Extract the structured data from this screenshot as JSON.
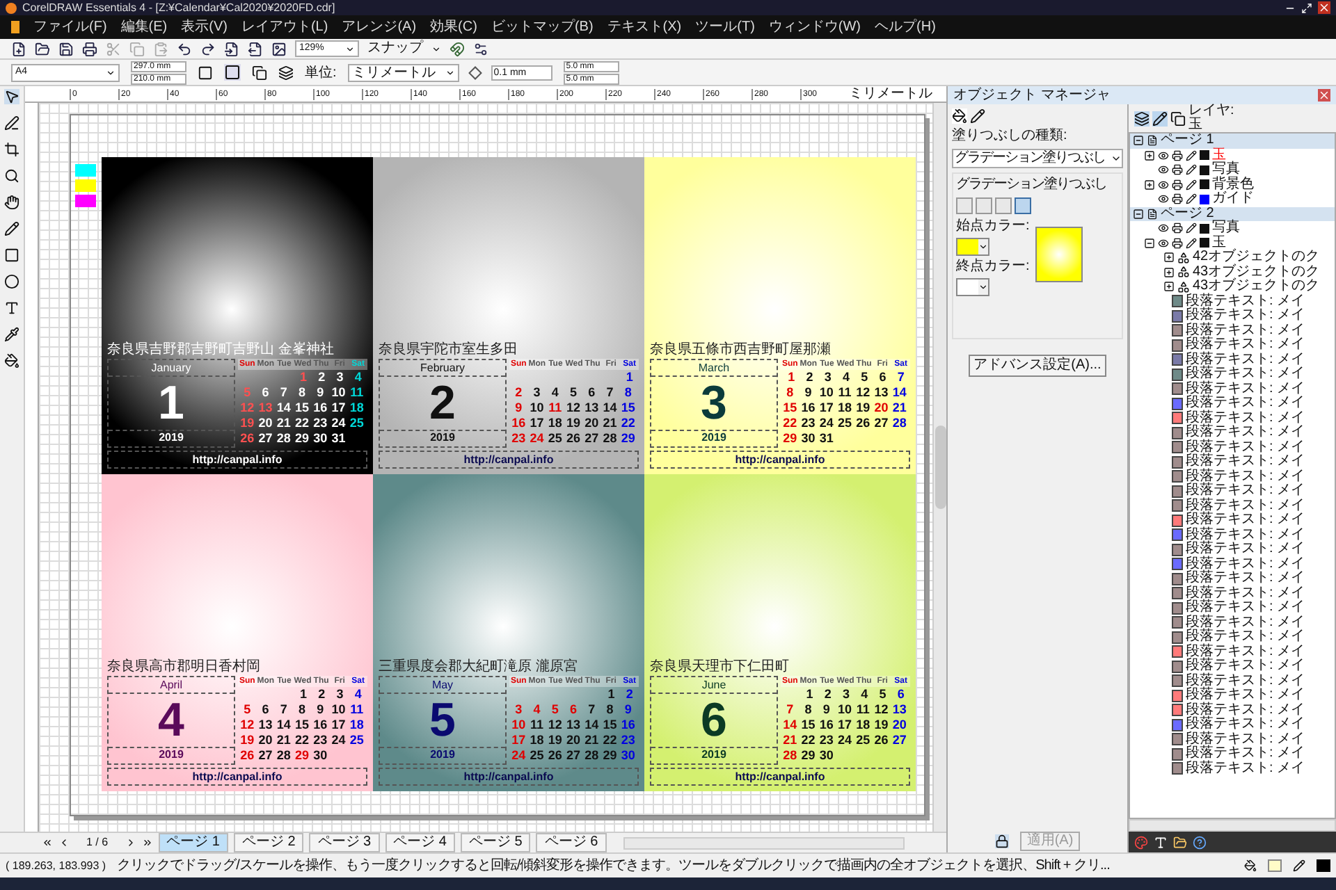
{
  "window": {
    "title": "CorelDRAW Essentials 4 - [Z:¥Calendar¥Cal2020¥2020FD.cdr]"
  },
  "menu": [
    "ファイル(F)",
    "編集(E)",
    "表示(V)",
    "レイアウト(L)",
    "アレンジ(A)",
    "効果(C)",
    "ビットマップ(B)",
    "テキスト(X)",
    "ツール(T)",
    "ウィンドウ(W)",
    "ヘルプ(H)"
  ],
  "toolbar": {
    "zoom": "129%",
    "snap": "スナップ"
  },
  "property_bar": {
    "page_size": "A4",
    "width": "297.0 mm",
    "height": "210.0 mm",
    "units_label": "単位:",
    "units": "ミリメートル",
    "nudge": "0.1 mm",
    "dup_x": "5.0 mm",
    "dup_y": "5.0 mm"
  },
  "ruler": {
    "ticks": [
      "0",
      "20",
      "40",
      "60",
      "80",
      "100",
      "120",
      "140",
      "160",
      "180",
      "200",
      "220",
      "240",
      "260",
      "280",
      "300"
    ],
    "unit": "ミリメートル"
  },
  "swatches": [
    {
      "color": "#00ffff"
    },
    {
      "color": "#ffff00"
    },
    {
      "color": "#ff00ff"
    }
  ],
  "months": [
    {
      "address": "奈良県吉野郡吉野町吉野山 金峯神社",
      "name": "January",
      "number": "1",
      "year": "2019",
      "url": "http://canpal.info",
      "color": "#000000",
      "kind": "dark",
      "weekdays": [
        "Sun",
        "Mon",
        "Tue",
        "Wed",
        "Thu",
        "Fri",
        "Sat"
      ],
      "weeks": [
        [
          {
            "text": "1",
            "kind": "holiday"
          },
          {
            "text": "2",
            "kind": "day"
          },
          {
            "text": "3",
            "kind": "day"
          },
          {
            "text": "4",
            "kind": "sat"
          }
        ],
        [
          {
            "text": "5",
            "kind": "sun"
          },
          {
            "text": "6",
            "kind": "day"
          },
          {
            "text": "7",
            "kind": "day"
          },
          {
            "text": "8",
            "kind": "day"
          },
          {
            "text": "9",
            "kind": "day"
          },
          {
            "text": "10",
            "kind": "day"
          },
          {
            "text": "11",
            "kind": "sat"
          }
        ],
        [
          {
            "text": "12",
            "kind": "sun"
          },
          {
            "text": "13",
            "kind": "holiday"
          },
          {
            "text": "14",
            "kind": "day"
          },
          {
            "text": "15",
            "kind": "day"
          },
          {
            "text": "16",
            "kind": "day"
          },
          {
            "text": "17",
            "kind": "day"
          },
          {
            "text": "18",
            "kind": "sat"
          }
        ],
        [
          {
            "text": "19",
            "kind": "sun"
          },
          {
            "text": "20",
            "kind": "day"
          },
          {
            "text": "21",
            "kind": "day"
          },
          {
            "text": "22",
            "kind": "day"
          },
          {
            "text": "23",
            "kind": "day"
          },
          {
            "text": "24",
            "kind": "day"
          },
          {
            "text": "25",
            "kind": "sat"
          }
        ],
        [
          {
            "text": "26",
            "kind": "sun"
          },
          {
            "text": "27",
            "kind": "day"
          },
          {
            "text": "28",
            "kind": "day"
          },
          {
            "text": "29",
            "kind": "day"
          },
          {
            "text": "30",
            "kind": "day"
          },
          {
            "text": "31",
            "kind": "day"
          }
        ]
      ]
    },
    {
      "address": "奈良県宇陀市室生多田",
      "name": "February",
      "number": "2",
      "year": "2019",
      "url": "http://canpal.info",
      "color": "#b4b4b4",
      "kind": "light",
      "weekdays": [
        "Sun",
        "Mon",
        "Tue",
        "Wed",
        "Thu",
        "Fri",
        "Sat"
      ],
      "weeks": [
        [
          {
            "text": "1",
            "kind": "sat"
          }
        ],
        [
          {
            "text": "2",
            "kind": "sun"
          },
          {
            "text": "3",
            "kind": "day"
          },
          {
            "text": "4",
            "kind": "day"
          },
          {
            "text": "5",
            "kind": "day"
          },
          {
            "text": "6",
            "kind": "day"
          },
          {
            "text": "7",
            "kind": "day"
          },
          {
            "text": "8",
            "kind": "sat"
          }
        ],
        [
          {
            "text": "9",
            "kind": "sun"
          },
          {
            "text": "10",
            "kind": "day"
          },
          {
            "text": "11",
            "kind": "holiday"
          },
          {
            "text": "12",
            "kind": "day"
          },
          {
            "text": "13",
            "kind": "day"
          },
          {
            "text": "14",
            "kind": "day"
          },
          {
            "text": "15",
            "kind": "sat"
          }
        ],
        [
          {
            "text": "16",
            "kind": "sun"
          },
          {
            "text": "17",
            "kind": "day"
          },
          {
            "text": "18",
            "kind": "day"
          },
          {
            "text": "19",
            "kind": "day"
          },
          {
            "text": "20",
            "kind": "day"
          },
          {
            "text": "21",
            "kind": "day"
          },
          {
            "text": "22",
            "kind": "sat"
          }
        ],
        [
          {
            "text": "23",
            "kind": "sun"
          },
          {
            "text": "24",
            "kind": "holiday"
          },
          {
            "text": "25",
            "kind": "day"
          },
          {
            "text": "26",
            "kind": "day"
          },
          {
            "text": "27",
            "kind": "day"
          },
          {
            "text": "28",
            "kind": "day"
          },
          {
            "text": "29",
            "kind": "sat"
          }
        ]
      ]
    },
    {
      "address": "奈良県五條市西吉野町屋那瀬",
      "name": "March",
      "number": "3",
      "year": "2019",
      "url": "http://canpal.info",
      "color": "#ffff9c",
      "kind": "light",
      "weekdays": [
        "Sun",
        "Mon",
        "Tue",
        "Wed",
        "Thu",
        "Fri",
        "Sat"
      ],
      "weeks": [
        [
          {
            "text": "1",
            "kind": "sun"
          },
          {
            "text": "2",
            "kind": "day"
          },
          {
            "text": "3",
            "kind": "day"
          },
          {
            "text": "4",
            "kind": "day"
          },
          {
            "text": "5",
            "kind": "day"
          },
          {
            "text": "6",
            "kind": "day"
          },
          {
            "text": "7",
            "kind": "sat"
          }
        ],
        [
          {
            "text": "8",
            "kind": "sun"
          },
          {
            "text": "9",
            "kind": "day"
          },
          {
            "text": "10",
            "kind": "day"
          },
          {
            "text": "11",
            "kind": "day"
          },
          {
            "text": "12",
            "kind": "day"
          },
          {
            "text": "13",
            "kind": "day"
          },
          {
            "text": "14",
            "kind": "sat"
          }
        ],
        [
          {
            "text": "15",
            "kind": "sun"
          },
          {
            "text": "16",
            "kind": "day"
          },
          {
            "text": "17",
            "kind": "day"
          },
          {
            "text": "18",
            "kind": "day"
          },
          {
            "text": "19",
            "kind": "day"
          },
          {
            "text": "20",
            "kind": "holiday"
          },
          {
            "text": "21",
            "kind": "sat"
          }
        ],
        [
          {
            "text": "22",
            "kind": "sun"
          },
          {
            "text": "23",
            "kind": "day"
          },
          {
            "text": "24",
            "kind": "day"
          },
          {
            "text": "25",
            "kind": "day"
          },
          {
            "text": "26",
            "kind": "day"
          },
          {
            "text": "27",
            "kind": "day"
          },
          {
            "text": "28",
            "kind": "sat"
          }
        ],
        [
          {
            "text": "29",
            "kind": "sun"
          },
          {
            "text": "30",
            "kind": "day"
          },
          {
            "text": "31",
            "kind": "day"
          }
        ]
      ]
    },
    {
      "address": "奈良県高市郡明日香村岡",
      "name": "April",
      "number": "4",
      "year": "2019",
      "url": "http://canpal.info",
      "color": "#ffc4d0",
      "kind": "light",
      "weekdays": [
        "Sun",
        "Mon",
        "Tue",
        "Wed",
        "Thu",
        "Fri",
        "Sat"
      ],
      "weeks": [
        [
          {
            "text": "1",
            "kind": "day"
          },
          {
            "text": "2",
            "kind": "day"
          },
          {
            "text": "3",
            "kind": "day"
          },
          {
            "text": "4",
            "kind": "sat"
          }
        ],
        [
          {
            "text": "5",
            "kind": "sun"
          },
          {
            "text": "6",
            "kind": "day"
          },
          {
            "text": "7",
            "kind": "day"
          },
          {
            "text": "8",
            "kind": "day"
          },
          {
            "text": "9",
            "kind": "day"
          },
          {
            "text": "10",
            "kind": "day"
          },
          {
            "text": "11",
            "kind": "sat"
          }
        ],
        [
          {
            "text": "12",
            "kind": "sun"
          },
          {
            "text": "13",
            "kind": "day"
          },
          {
            "text": "14",
            "kind": "day"
          },
          {
            "text": "15",
            "kind": "day"
          },
          {
            "text": "16",
            "kind": "day"
          },
          {
            "text": "17",
            "kind": "day"
          },
          {
            "text": "18",
            "kind": "sat"
          }
        ],
        [
          {
            "text": "19",
            "kind": "sun"
          },
          {
            "text": "20",
            "kind": "day"
          },
          {
            "text": "21",
            "kind": "day"
          },
          {
            "text": "22",
            "kind": "day"
          },
          {
            "text": "23",
            "kind": "day"
          },
          {
            "text": "24",
            "kind": "day"
          },
          {
            "text": "25",
            "kind": "sat"
          }
        ],
        [
          {
            "text": "26",
            "kind": "sun"
          },
          {
            "text": "27",
            "kind": "day"
          },
          {
            "text": "28",
            "kind": "day"
          },
          {
            "text": "29",
            "kind": "holiday"
          },
          {
            "text": "30",
            "kind": "day"
          }
        ]
      ]
    },
    {
      "address": "三重県度会郡大紀町滝原 瀧原宮",
      "name": "May",
      "number": "5",
      "year": "2019",
      "url": "http://canpal.info",
      "color": "#5e8a8a",
      "kind": "light",
      "weekdays": [
        "Sun",
        "Mon",
        "Tue",
        "Wed",
        "Thu",
        "Fri",
        "Sat"
      ],
      "weeks": [
        [
          {
            "text": "1",
            "kind": "day"
          },
          {
            "text": "2",
            "kind": "sat"
          }
        ],
        [
          {
            "text": "3",
            "kind": "sun"
          },
          {
            "text": "4",
            "kind": "holiday"
          },
          {
            "text": "5",
            "kind": "holiday"
          },
          {
            "text": "6",
            "kind": "holiday"
          },
          {
            "text": "7",
            "kind": "day"
          },
          {
            "text": "8",
            "kind": "day"
          },
          {
            "text": "9",
            "kind": "sat"
          }
        ],
        [
          {
            "text": "10",
            "kind": "sun"
          },
          {
            "text": "11",
            "kind": "day"
          },
          {
            "text": "12",
            "kind": "day"
          },
          {
            "text": "13",
            "kind": "day"
          },
          {
            "text": "14",
            "kind": "day"
          },
          {
            "text": "15",
            "kind": "day"
          },
          {
            "text": "16",
            "kind": "sat"
          }
        ],
        [
          {
            "text": "17",
            "kind": "sun"
          },
          {
            "text": "18",
            "kind": "day"
          },
          {
            "text": "19",
            "kind": "day"
          },
          {
            "text": "20",
            "kind": "day"
          },
          {
            "text": "21",
            "kind": "day"
          },
          {
            "text": "22",
            "kind": "day"
          },
          {
            "text": "23",
            "kind": "sat"
          }
        ],
        [
          {
            "text": "24",
            "kind": "sun"
          },
          {
            "text": "25",
            "kind": "day"
          },
          {
            "text": "26",
            "kind": "day"
          },
          {
            "text": "27",
            "kind": "day"
          },
          {
            "text": "28",
            "kind": "day"
          },
          {
            "text": "29",
            "kind": "day"
          },
          {
            "text": "30",
            "kind": "sat"
          }
        ]
      ]
    },
    {
      "address": "奈良県天理市下仁田町",
      "name": "June",
      "number": "6",
      "year": "2019",
      "url": "http://canpal.info",
      "color": "#d4f070",
      "kind": "light",
      "weekdays": [
        "Sun",
        "Mon",
        "Tue",
        "Wed",
        "Thu",
        "Fri",
        "Sat"
      ],
      "weeks": [
        [
          {
            "text": "1",
            "kind": "day"
          },
          {
            "text": "2",
            "kind": "day"
          },
          {
            "text": "3",
            "kind": "day"
          },
          {
            "text": "4",
            "kind": "day"
          },
          {
            "text": "5",
            "kind": "day"
          },
          {
            "text": "6",
            "kind": "sat"
          }
        ],
        [
          {
            "text": "7",
            "kind": "sun"
          },
          {
            "text": "8",
            "kind": "day"
          },
          {
            "text": "9",
            "kind": "day"
          },
          {
            "text": "10",
            "kind": "day"
          },
          {
            "text": "11",
            "kind": "day"
          },
          {
            "text": "12",
            "kind": "day"
          },
          {
            "text": "13",
            "kind": "sat"
          }
        ],
        [
          {
            "text": "14",
            "kind": "sun"
          },
          {
            "text": "15",
            "kind": "day"
          },
          {
            "text": "16",
            "kind": "day"
          },
          {
            "text": "17",
            "kind": "day"
          },
          {
            "text": "18",
            "kind": "day"
          },
          {
            "text": "19",
            "kind": "day"
          },
          {
            "text": "20",
            "kind": "sat"
          }
        ],
        [
          {
            "text": "21",
            "kind": "sun"
          },
          {
            "text": "22",
            "kind": "day"
          },
          {
            "text": "23",
            "kind": "day"
          },
          {
            "text": "24",
            "kind": "day"
          },
          {
            "text": "25",
            "kind": "day"
          },
          {
            "text": "26",
            "kind": "day"
          },
          {
            "text": "27",
            "kind": "sat"
          }
        ],
        [
          {
            "text": "28",
            "kind": "sun"
          },
          {
            "text": "29",
            "kind": "day"
          },
          {
            "text": "30",
            "kind": "day"
          }
        ]
      ]
    }
  ],
  "page_nav": {
    "counter": "1 / 6",
    "tabs": [
      {
        "label": "ページ 1",
        "selected": true
      },
      {
        "label": "ページ 2",
        "selected": false
      },
      {
        "label": "ページ 3",
        "selected": false
      },
      {
        "label": "ページ 4",
        "selected": false
      },
      {
        "label": "ページ 5",
        "selected": false
      },
      {
        "label": "ページ 6",
        "selected": false
      }
    ]
  },
  "docker": {
    "title": "オブジェクト マネージャ",
    "fill_type_label": "塗りつぶしの種類:",
    "fill_type": "グラデーション塗りつぶし",
    "group_label": "グラデーション塗りつぶし",
    "gradient_types": [
      {
        "selected": false
      },
      {
        "selected": false
      },
      {
        "selected": false
      },
      {
        "selected": true
      }
    ],
    "start": {
      "label": "始点カラー:",
      "color": "#ffff00"
    },
    "end": {
      "label": "終点カラー:",
      "color": "#ffffff"
    },
    "advanced": "アドバンス設定(A)...",
    "apply": {
      "label": "適用(A)",
      "disabled": true
    }
  },
  "object_manager": {
    "layer_label": "レイヤ:",
    "layer": "玉",
    "tree": [
      {
        "label": "ページ 1",
        "kind": "page",
        "expanded": true,
        "children": [
          {
            "label": "玉",
            "kind": "layer",
            "active": true,
            "expanded": false,
            "color": "#111111"
          },
          {
            "label": "写真",
            "kind": "layer",
            "active": false,
            "color": "#111111"
          },
          {
            "label": "背景色",
            "kind": "layer",
            "active": false,
            "expanded": false,
            "color": "#111111"
          },
          {
            "label": "ガイド",
            "kind": "layer",
            "active": false,
            "color": "#0000ff"
          }
        ]
      },
      {
        "label": "ページ 2",
        "kind": "page",
        "expanded": true,
        "children": [
          {
            "label": "写真",
            "kind": "layer",
            "active": false,
            "color": "#111111"
          },
          {
            "label": "玉",
            "kind": "layer",
            "active": false,
            "expanded": true,
            "color": "#111111",
            "children": [
              {
                "label": "42オブジェクトのク",
                "kind": "group",
                "expanded": false
              },
              {
                "label": "43オブジェクトのク",
                "kind": "group",
                "expanded": false
              },
              {
                "label": "43オブジェクトのク",
                "kind": "group",
                "expanded": false
              },
              {
                "label": "段落テキスト: メイ",
                "kind": "text",
                "color": "#6e8a88"
              },
              {
                "label": "段落テキスト: メイ",
                "kind": "text",
                "color": "#7a7aa8"
              },
              {
                "label": "段落テキスト: メイ",
                "kind": "text",
                "color": "#a08c8c"
              },
              {
                "label": "段落テキスト: メイ",
                "kind": "text",
                "color": "#a08c8c"
              },
              {
                "label": "段落テキスト: メイ",
                "kind": "text",
                "color": "#7a7aa8"
              },
              {
                "label": "段落テキスト: メイ",
                "kind": "text",
                "color": "#6e8a88"
              },
              {
                "label": "段落テキスト: メイ",
                "kind": "text",
                "color": "#a08c8c"
              },
              {
                "label": "段落テキスト: メイ",
                "kind": "text",
                "color": "#6a6aff"
              },
              {
                "label": "段落テキスト: メイ",
                "kind": "text",
                "color": "#ff7a7a"
              },
              {
                "label": "段落テキスト: メイ",
                "kind": "text",
                "color": "#a08c8c"
              },
              {
                "label": "段落テキスト: メイ",
                "kind": "text",
                "color": "#a08c8c"
              },
              {
                "label": "段落テキスト: メイ",
                "kind": "text",
                "color": "#a08c8c"
              },
              {
                "label": "段落テキスト: メイ",
                "kind": "text",
                "color": "#a08c8c"
              },
              {
                "label": "段落テキスト: メイ",
                "kind": "text",
                "color": "#a08c8c"
              },
              {
                "label": "段落テキスト: メイ",
                "kind": "text",
                "color": "#a08c8c"
              },
              {
                "label": "段落テキスト: メイ",
                "kind": "text",
                "color": "#ff7a7a"
              },
              {
                "label": "段落テキスト: メイ",
                "kind": "text",
                "color": "#6a6aff"
              },
              {
                "label": "段落テキスト: メイ",
                "kind": "text",
                "color": "#a08c8c"
              },
              {
                "label": "段落テキスト: メイ",
                "kind": "text",
                "color": "#6a6aff"
              },
              {
                "label": "段落テキスト: メイ",
                "kind": "text",
                "color": "#a08c8c"
              },
              {
                "label": "段落テキスト: メイ",
                "kind": "text",
                "color": "#a08c8c"
              },
              {
                "label": "段落テキスト: メイ",
                "kind": "text",
                "color": "#a08c8c"
              },
              {
                "label": "段落テキスト: メイ",
                "kind": "text",
                "color": "#a08c8c"
              },
              {
                "label": "段落テキスト: メイ",
                "kind": "text",
                "color": "#a08c8c"
              },
              {
                "label": "段落テキスト: メイ",
                "kind": "text",
                "color": "#ff7a7a"
              },
              {
                "label": "段落テキスト: メイ",
                "kind": "text",
                "color": "#a08c8c"
              },
              {
                "label": "段落テキスト: メイ",
                "kind": "text",
                "color": "#a08c8c"
              },
              {
                "label": "段落テキスト: メイ",
                "kind": "text",
                "color": "#ff7a7a"
              },
              {
                "label": "段落テキスト: メイ",
                "kind": "text",
                "color": "#ff7a7a"
              },
              {
                "label": "段落テキスト: メイ",
                "kind": "text",
                "color": "#6a6aff"
              },
              {
                "label": "段落テキスト: メイ",
                "kind": "text",
                "color": "#a08c8c"
              },
              {
                "label": "段落テキスト: メイ",
                "kind": "text",
                "color": "#a08c8c"
              },
              {
                "label": "段落テキスト: メイ",
                "kind": "text",
                "color": "#a08c8c"
              }
            ]
          }
        ]
      }
    ]
  },
  "status_bar": {
    "coords": "( 189.263, 183.993 )",
    "message": "クリックでドラッグ/スケールを操作、もう一度クリックすると回転/傾斜変形を操作できます。ツールをダブルクリックで描画内の全オブジェクトを選択、Shift + クリ..."
  }
}
